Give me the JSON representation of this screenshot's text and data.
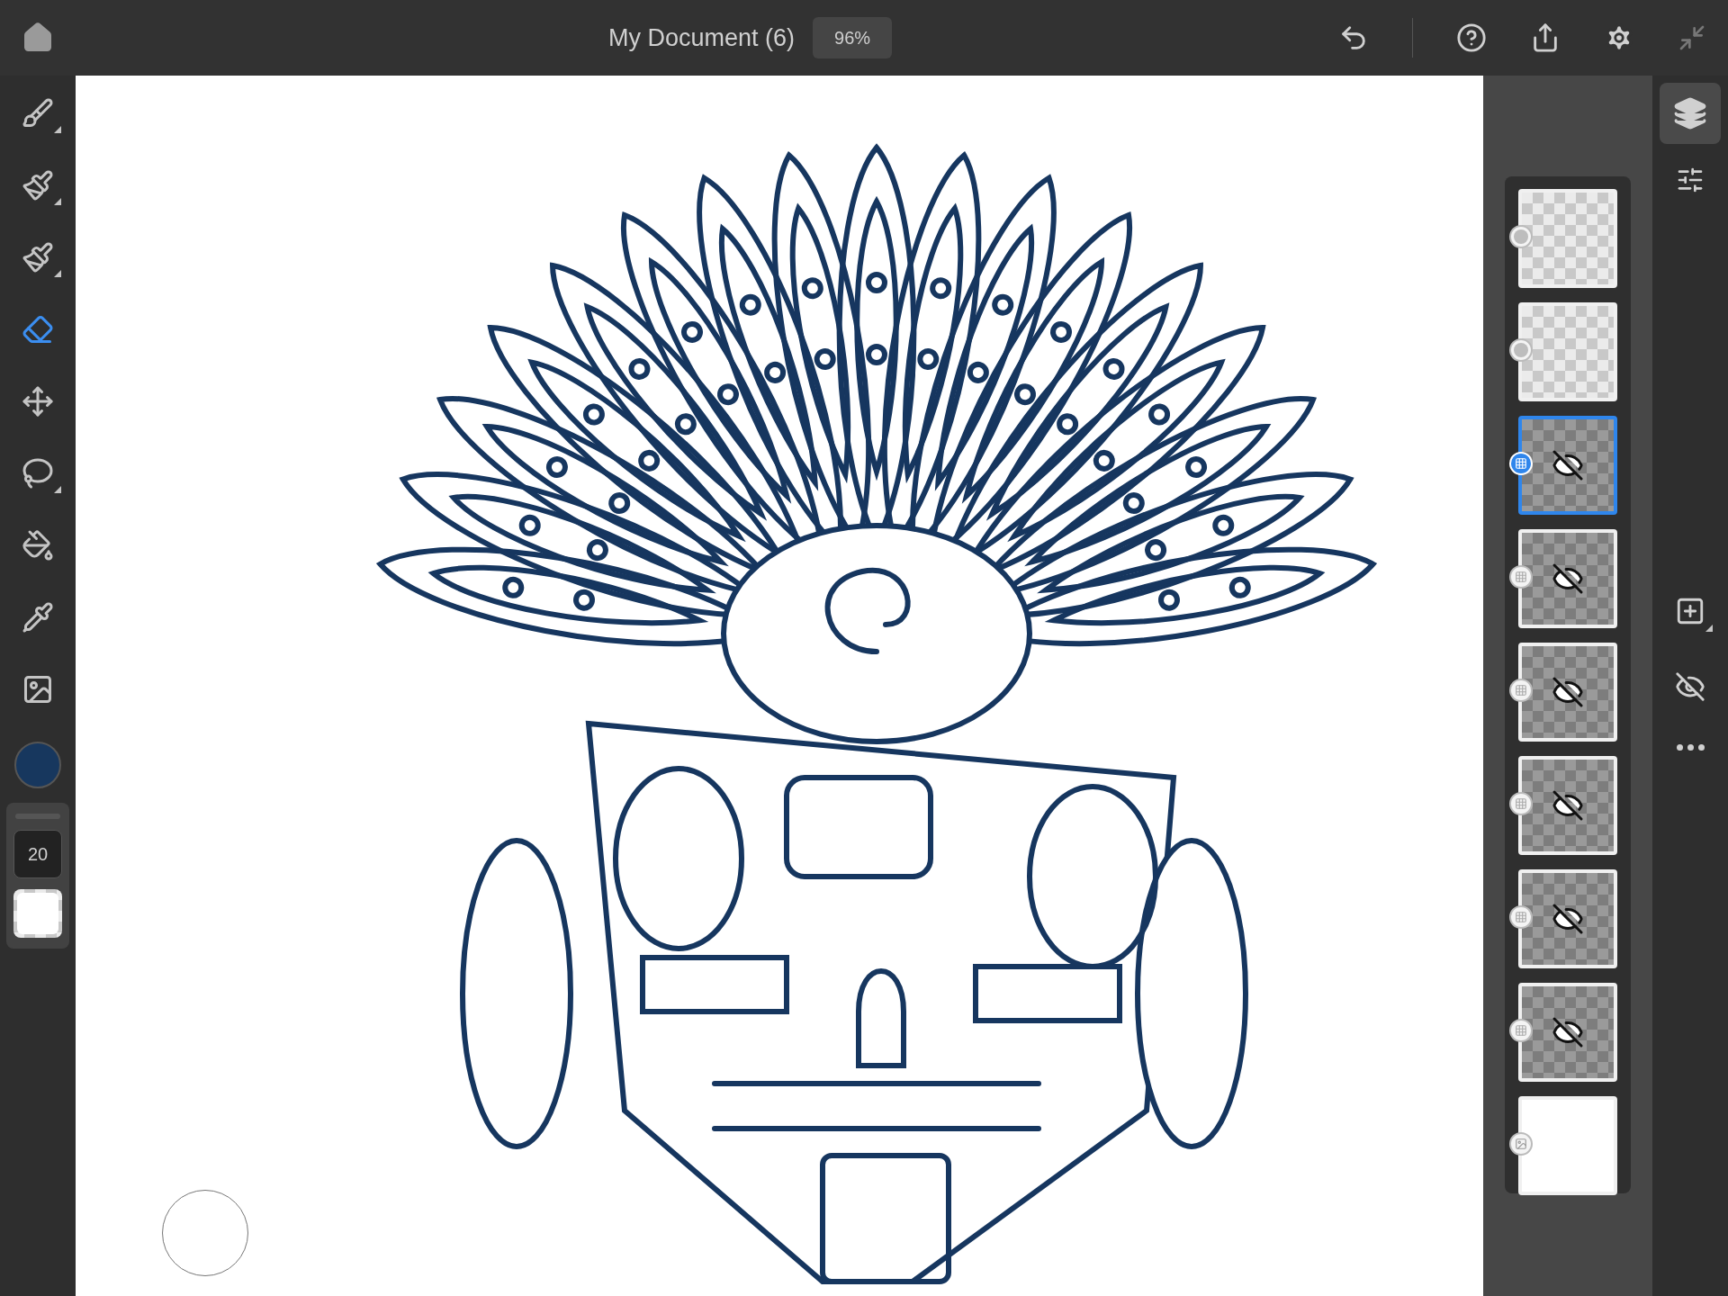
{
  "top_bar": {
    "title": "My Document (6)",
    "zoom": "96%"
  },
  "tools": [
    {
      "kind": "pixel-brush",
      "selected": false
    },
    {
      "kind": "live-brush",
      "selected": false
    },
    {
      "kind": "vector-brush",
      "selected": false
    },
    {
      "kind": "eraser",
      "selected": true
    },
    {
      "kind": "move",
      "selected": false
    },
    {
      "kind": "lasso",
      "selected": false
    },
    {
      "kind": "fill",
      "selected": false
    },
    {
      "kind": "eyedropper",
      "selected": false
    },
    {
      "kind": "image",
      "selected": false
    }
  ],
  "brush_size": "20",
  "layers": [
    {
      "kind": "vector",
      "hidden": false,
      "selected": false
    },
    {
      "kind": "vector",
      "hidden": false,
      "selected": false
    },
    {
      "kind": "pixel",
      "hidden": true,
      "selected": true
    },
    {
      "kind": "pixel",
      "hidden": true,
      "selected": false
    },
    {
      "kind": "pixel",
      "hidden": true,
      "selected": false
    },
    {
      "kind": "pixel",
      "hidden": true,
      "selected": false
    },
    {
      "kind": "pixel",
      "hidden": true,
      "selected": false
    },
    {
      "kind": "pixel",
      "hidden": true,
      "selected": false
    },
    {
      "kind": "background",
      "hidden": false,
      "selected": false
    }
  ]
}
